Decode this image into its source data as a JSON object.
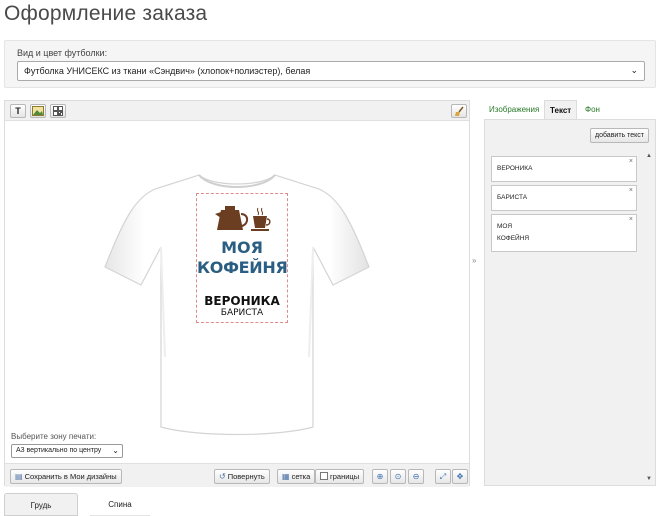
{
  "page": {
    "title": "Оформление заказа"
  },
  "product": {
    "label": "Вид и цвет футболки:",
    "selected": "Футболка УНИСЕКС из ткани «Сэндвич» (хлопок+полиэстер), белая",
    "chevron_icon": "chevron-down-icon"
  },
  "toolbar": {
    "text_tool": "T",
    "image_tool_icon": "image-icon",
    "grid_tool_icon": "qr-grid-icon",
    "clear_tool_icon": "broom-icon"
  },
  "design": {
    "line1": "МОЯ",
    "line2": "КОФЕЙНЯ",
    "name": "ВЕРОНИКА",
    "role": "БАРИСТА",
    "title_color": "#2a5e82",
    "coffee_color": "#6b3e22"
  },
  "print_zone": {
    "label": "Выберите зону печати:",
    "selected": "А3 вертикально по центру"
  },
  "bottom_bar": {
    "save": "Сохранить в Мои дизайны",
    "rotate": "Повернуть",
    "grid": "сетка",
    "borders": "границы"
  },
  "tabs": {
    "images": "Изображения",
    "text": "Текст",
    "background": "Фон"
  },
  "text_panel": {
    "add_button": "добавить текст",
    "items": [
      {
        "line1": "ВЕРОНИКА",
        "line2": ""
      },
      {
        "line1": "БАРИСТА",
        "line2": ""
      },
      {
        "line1": "МОЯ",
        "line2": "КОФЕЙНЯ"
      }
    ]
  },
  "side_tabs": {
    "front": "Грудь",
    "back": "Спина"
  }
}
